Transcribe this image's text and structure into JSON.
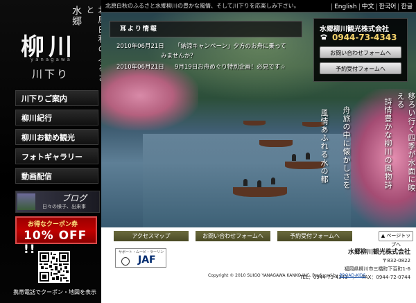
{
  "header": {
    "tagline": "北原白秋のふるさと水郷柳川の豊かな風情、そして川下りを応楽しみ下さい。",
    "languages": [
      "English",
      "中文",
      "한국어",
      "한글"
    ]
  },
  "logo": {
    "region": "水郷",
    "subtitle": "北原白秋のふるさと",
    "name": "柳川",
    "roman": "yanagawa",
    "activity": "川下り"
  },
  "nav": {
    "items": [
      "川下りご案内",
      "柳川紀行",
      "柳川お勧め観光",
      "フォトギャラリー",
      "動画配信"
    ]
  },
  "blog": {
    "title": "ブログ",
    "subtitle": "日々の様子、出来事"
  },
  "coupon": {
    "label": "お得なクーポン券",
    "offer": "10% OFF !!"
  },
  "mobile_note": "携帯電話でクーポン・地図を表示",
  "news": {
    "header": "耳より情報",
    "items": [
      {
        "date": "2010年06月21日",
        "text": "「納涼キャンペーン」夕方のお舟に乗って",
        "text2": "みませんか？"
      },
      {
        "date": "2010年06月21日",
        "text": "9月19日お舟めぐり特別企画！必見です☆",
        "text2": ""
      }
    ]
  },
  "company": {
    "name": "水郷柳川観光株式会社",
    "phone": "0944-73-4343",
    "contact_button": "お問い合わせフォームへ",
    "reserve_button": "予約受付フォームへ"
  },
  "poem": {
    "lines": [
      "移ろい行く四季が水面に映える",
      "詩情豊かな柳川の風物詩",
      "舟旅の中に懐かしさを",
      "風情あふれる水の都"
    ]
  },
  "lower_nav": {
    "access": "アクセスマップ",
    "contact": "お問い合わせフォームへ",
    "reserve": "予約受付フォームへ",
    "pagetop": "▲ ページトップへ"
  },
  "jaf": {
    "small": "サポート・ムービ・ラーリン",
    "text": "JAF"
  },
  "footer": {
    "company": "水郷柳川観光株式会社",
    "postal": "〒832-0822",
    "address": "福岡県柳川市三橋町下百町1-6",
    "tel_fax": "TEL：0944-73-4343　／　FAX：0944-72-0744",
    "copyright": "Copyright © 2010 SUIGO YANAGAWA KANKO INC. Produced by",
    "producer": "BROAD-KIDS"
  },
  "colors": {
    "background": "#0a0a0a",
    "accent_phone": "#f6d46b",
    "coupon_red": "#c00000",
    "lower_button": "#5a5a30"
  }
}
